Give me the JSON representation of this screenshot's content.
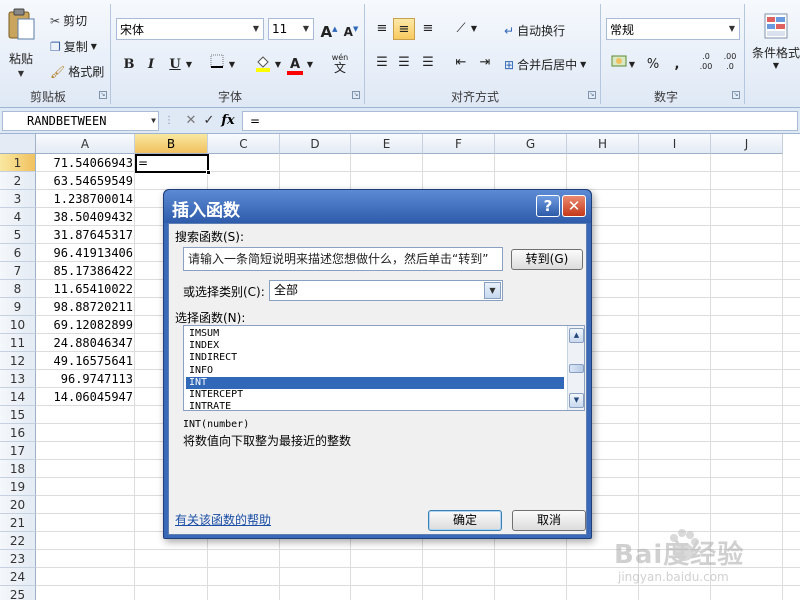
{
  "ribbon": {
    "clipboard": {
      "paste": "粘贴",
      "cut": "剪切",
      "copy": "复制",
      "format_painter": "格式刷",
      "group": "剪贴板"
    },
    "font": {
      "name": "宋体",
      "size": "11",
      "bold": "B",
      "italic": "I",
      "underline": "U",
      "grow": "A",
      "shrink": "A",
      "wen": "wén",
      "wen_char": "文",
      "font_color_letter": "A",
      "group": "字体"
    },
    "alignment": {
      "wrap": "自动换行",
      "merge": "合并后居中",
      "group": "对齐方式"
    },
    "number": {
      "format": "常规",
      "percent": "%",
      "comma": ",",
      "inc_dec": ".0 .00",
      "dec_dec": ".00 .0",
      "group": "数字"
    },
    "styles": {
      "conditional": "条件格式"
    }
  },
  "formula_bar": {
    "name_box": "RANDBETWEEN",
    "fx": "fx",
    "cancel": "✕",
    "enter": "✓",
    "formula": "="
  },
  "columns": [
    "A",
    "B",
    "C",
    "D",
    "E",
    "F",
    "G",
    "H",
    "I",
    "J"
  ],
  "rows": [
    "1",
    "2",
    "3",
    "4",
    "5",
    "6",
    "7",
    "8",
    "9",
    "10",
    "11",
    "12",
    "13",
    "14",
    "15",
    "16",
    "17",
    "18",
    "19",
    "20",
    "21",
    "22",
    "23",
    "24",
    "25"
  ],
  "column_a_values": [
    "71.54066943",
    "63.54659549",
    "1.238700014",
    "38.50409432",
    "31.87645317",
    "96.41913406",
    "85.17386422",
    "11.65410022",
    "98.88720211",
    "69.12082899",
    "24.88046347",
    "49.16575641",
    "96.9747113",
    "14.06045947"
  ],
  "active_cell": {
    "content": "="
  },
  "dialog": {
    "title": "插入函数",
    "help": "?",
    "close": "✕",
    "search_label": "搜索函数(S):",
    "search_value": "请输入一条简短说明来描述您想做什么，然后单击“转到”",
    "go_button": "转到(G)",
    "category_label": "或选择类别(C):",
    "category_value": "全部",
    "select_label": "选择函数(N):",
    "functions": [
      "IMSUM",
      "INDEX",
      "INDIRECT",
      "INFO",
      "INT",
      "INTERCEPT",
      "INTRATE"
    ],
    "selected_function": "INT",
    "syntax": "INT(number)",
    "description": "将数值向下取整为最接近的整数",
    "help_link": "有关该函数的帮助",
    "ok": "确定",
    "cancel": "取消"
  },
  "watermark": {
    "brand": "Bai度经验",
    "url": "jingyan.baidu.com"
  },
  "colors": {
    "selection": "#3168b8",
    "title_bar": "#2e5cab",
    "close_button": "#c4381a"
  }
}
